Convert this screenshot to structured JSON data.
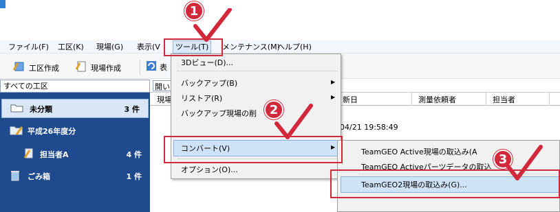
{
  "menubar": {
    "items": [
      "ファイル(F)",
      "工区(K)",
      "現場(G)",
      "表示(V",
      "ツール(T)",
      "メンテナンス(M)",
      "ヘルプ(H)"
    ]
  },
  "toolbar": {
    "koku_create": "工区作成",
    "genba_create": "現場作成",
    "extra": "表"
  },
  "headers": {
    "all_koku": "すべての工区",
    "open": "開い",
    "genba": "現場",
    "updated": "新日",
    "survey_requester": "測量依頼者",
    "person_in_charge": "担当者"
  },
  "tree": {
    "items": [
      {
        "label": "未分類",
        "count": "3 件"
      },
      {
        "label": "平成26年度分",
        "count": ""
      },
      {
        "label": "担当者A",
        "count": "4 件"
      },
      {
        "label": "ごみ箱",
        "count": "1 件"
      }
    ]
  },
  "list": {
    "date": "04/21 19:58:49"
  },
  "tools_menu": {
    "items": [
      "3Dビュー(D)...",
      "バックアップ(B)",
      "リストア(R)",
      "バックアップ現場の削",
      "コンバート(V)",
      "オプション(O)..."
    ]
  },
  "convert_submenu": {
    "items": [
      "TeamGEO Active現場の取込み(A",
      "TeamGEO Activeパーツデータの取込",
      "TeamGEO2現場の取込み(G)..."
    ]
  },
  "annotations": {
    "step1": "1",
    "step2": "2",
    "step3": "3"
  },
  "colors": {
    "annotation_red": "#d2283c",
    "tree_background": "#1f4b8e",
    "highlight": "#cfe3f7"
  }
}
